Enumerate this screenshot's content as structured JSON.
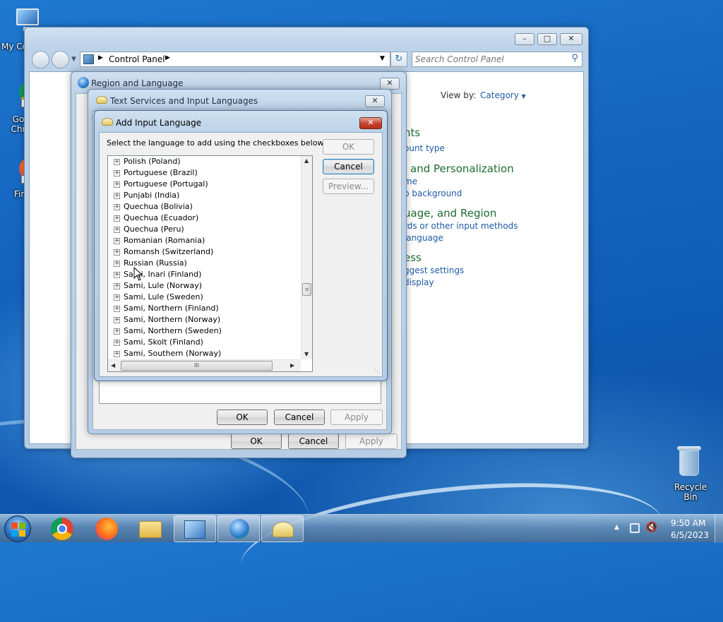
{
  "desktop": {
    "icons": [
      {
        "label": "My Co"
      },
      {
        "label": "Go Chr"
      },
      {
        "label": "Fir"
      },
      {
        "label": "Recycle Bin"
      }
    ]
  },
  "control_panel": {
    "breadcrumb": "Control Panel",
    "search_placeholder": "Search Control Panel",
    "view_by_label": "View by:",
    "view_by_value": "Category",
    "categories": [
      {
        "title": "nts",
        "links": [
          "ount type"
        ]
      },
      {
        "title": "and Personalization",
        "links": [
          "me",
          "p background"
        ]
      },
      {
        "title": "uage, and Region",
        "links": [
          "rds or other input methods",
          "language"
        ]
      },
      {
        "title": "ess",
        "links": [
          "ggest settings",
          "display"
        ]
      }
    ]
  },
  "region_dialog": {
    "title": "Region and Language",
    "ok": "OK",
    "cancel": "Cancel",
    "apply": "Apply"
  },
  "text_services_dialog": {
    "title": "Text Services and Input Languages",
    "ok": "OK",
    "cancel": "Cancel",
    "apply": "Apply"
  },
  "add_language_dialog": {
    "title": "Add Input Language",
    "instruction": "Select the language to add using the checkboxes below.",
    "ok": "OK",
    "cancel": "Cancel",
    "preview": "Preview...",
    "languages": [
      "Polish (Poland)",
      "Portuguese (Brazil)",
      "Portuguese (Portugal)",
      "Punjabi (India)",
      "Quechua (Bolivia)",
      "Quechua (Ecuador)",
      "Quechua (Peru)",
      "Romanian (Romania)",
      "Romansh (Switzerland)",
      "Russian (Russia)",
      "Sami, Inari (Finland)",
      "Sami, Lule (Norway)",
      "Sami, Lule (Sweden)",
      "Sami, Northern (Finland)",
      "Sami, Northern (Norway)",
      "Sami, Northern (Sweden)",
      "Sami, Skolt (Finland)",
      "Sami, Southern (Norway)"
    ],
    "hscroll_grip": "III"
  },
  "taskbar": {
    "time": "9:50 AM",
    "date": "6/5/2023"
  }
}
